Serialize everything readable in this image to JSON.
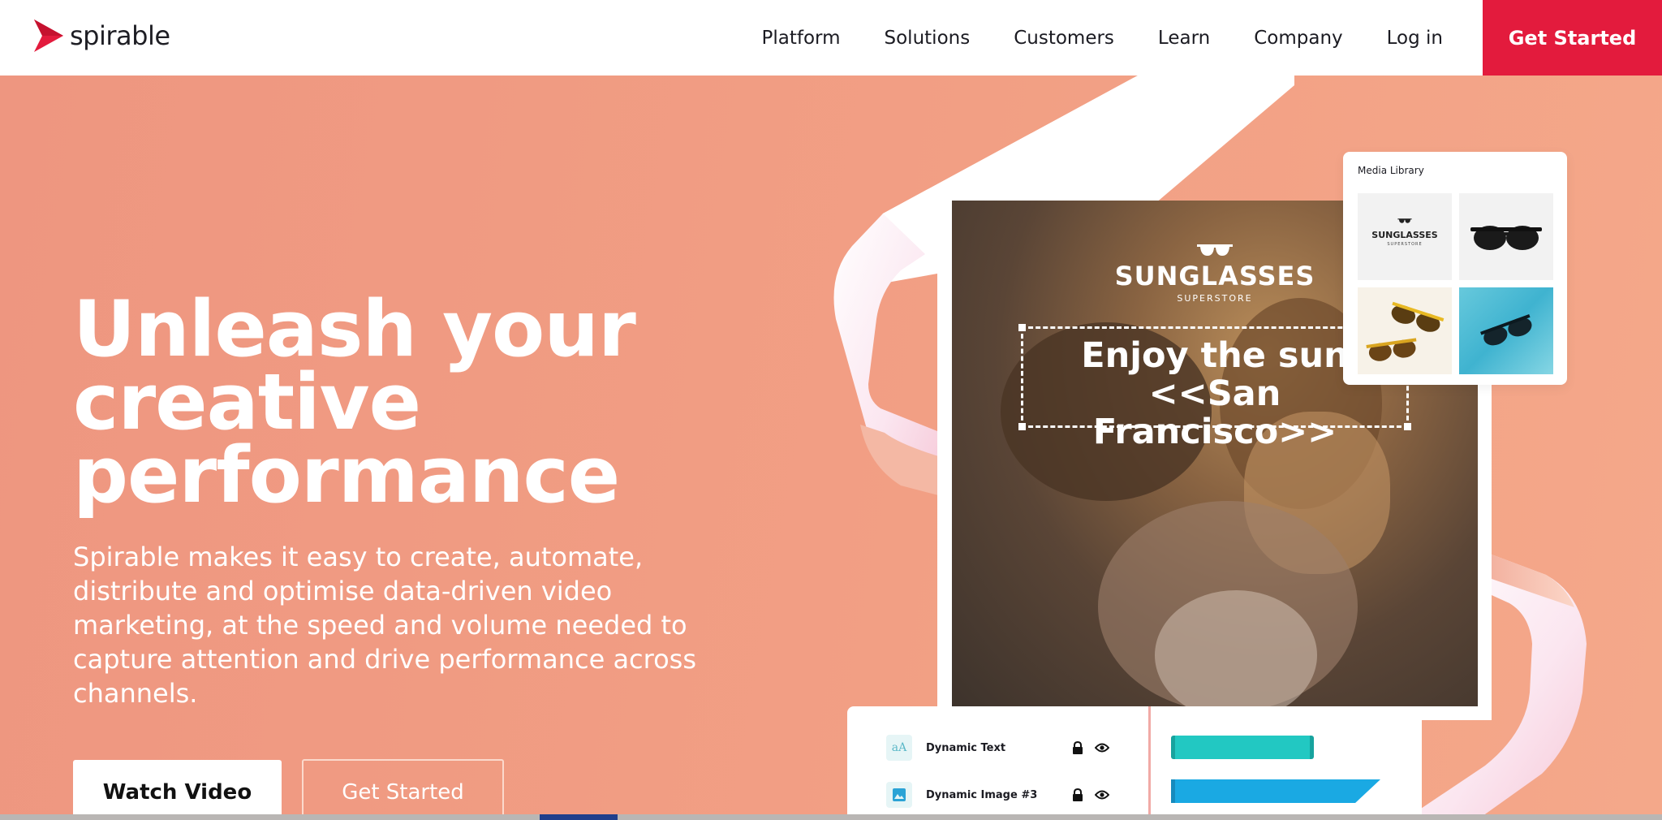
{
  "header": {
    "logo_text": "spirable",
    "nav": [
      "Platform",
      "Solutions",
      "Customers",
      "Learn",
      "Company",
      "Log in"
    ],
    "cta": "Get Started"
  },
  "hero": {
    "title_lines": [
      "Unleash your",
      "creative",
      "performance"
    ],
    "body": "Spirable makes it easy to create, automate, distribute and optimise data-driven video marketing, at the speed and volume needed to capture attention and drive performance across channels.",
    "watch_button": "Watch Video",
    "start_button": "Get Started"
  },
  "video": {
    "brand": "SUNGLASSES",
    "brand_sub": "SUPERSTORE",
    "caption_line1": "Enjoy the sun",
    "caption_line2": "<<San Francisco>>"
  },
  "media_library": {
    "title": "Media Library",
    "tile_brand": "SUNGLASSES",
    "tile_brand_sub": "SUPERSTORE"
  },
  "layers": [
    {
      "label": "Dynamic Text",
      "icon": "text-icon"
    },
    {
      "label": "Dynamic Image #3",
      "icon": "image-icon"
    }
  ],
  "colors": {
    "brand_red": "#e31b3d",
    "hero_bg": "#f29f84",
    "teal_bar": "#22c8c2",
    "blue_bar": "#1aa9e3"
  }
}
